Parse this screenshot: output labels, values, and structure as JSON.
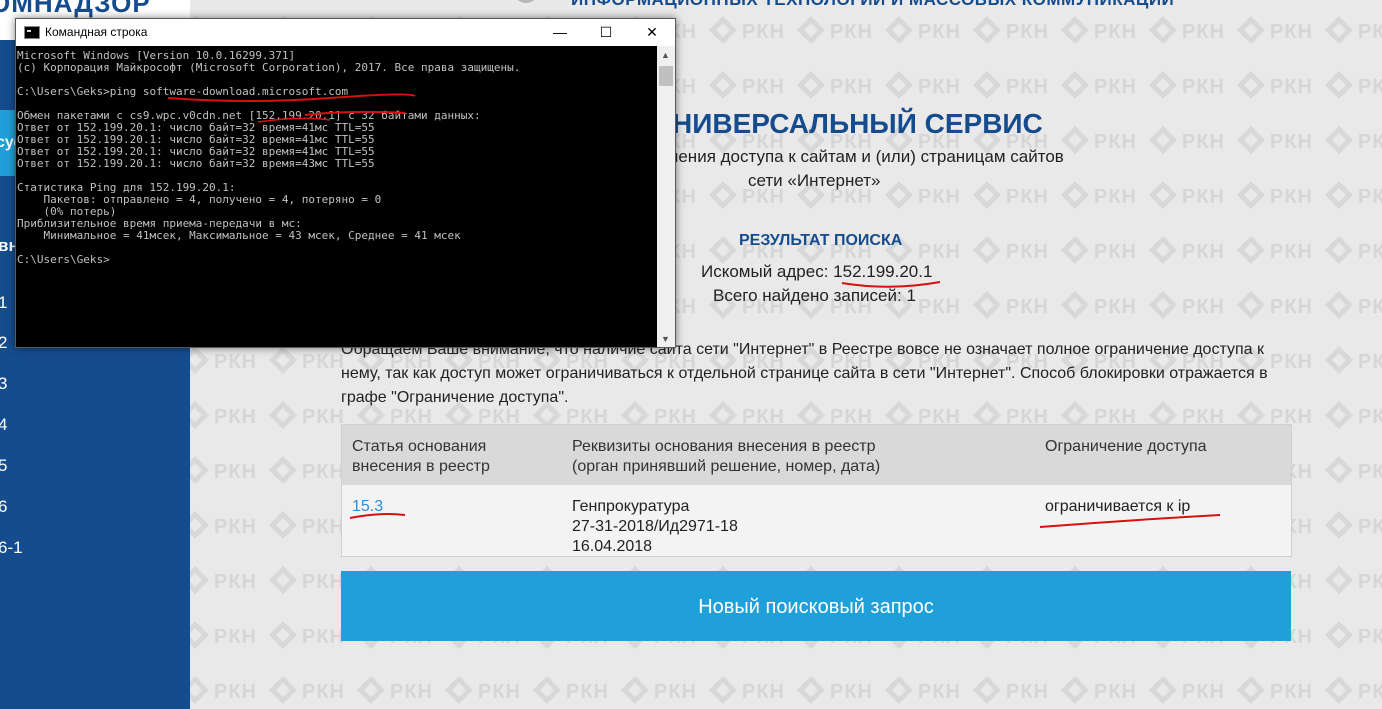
{
  "header": {
    "top_title": "ИНФОРМАЦИОННЫХ ТЕХНОЛОГИЙ И МАССОВЫХ КОММУНИКАЦИЙ",
    "logo_text": "ОМНАДЗОР"
  },
  "watermark_text": "РКН",
  "sidebar": {
    "active_label": "сус",
    "section_label": "вн",
    "items": [
      "1",
      "2",
      "3",
      "4",
      "5",
      "6",
      "6-1"
    ]
  },
  "service": {
    "title": "НИВЕРСАЛЬНЫЙ СЕРВИС",
    "subtitle_line1": "ичения доступа к сайтам и (или) страницам сайтов",
    "subtitle_line2": "сети «Интернет»"
  },
  "result": {
    "title": "РЕЗУЛЬТАТ ПОИСКА",
    "address_label": "Искомый адрес: ",
    "address_value": "152.199.20.1",
    "count_label": "Всего найдено записей: ",
    "count_value": "1"
  },
  "notice": "Обращаем Ваше внимание, что наличие сайта сети \"Интернет\" в Реестре вовсе не означает полное ограничение доступа к нему, так как доступ может ограничиваться к отдельной странице сайта в сети \"Интернет\". Способ блокировки отражается в графе \"Ограничение доступа\".",
  "table": {
    "headers": [
      [
        "Статья основания",
        "внесения в реестр"
      ],
      [
        "Реквизиты основания внесения в реестр",
        "(орган принявший решение, номер, дата)"
      ],
      [
        "Ограничение доступа"
      ]
    ],
    "row": {
      "article": "15.3",
      "details": [
        "Генпрокуратура",
        "27-31-2018/Ид2971-18",
        "16.04.2018"
      ],
      "restriction": "ограничивается к ip"
    }
  },
  "new_search_label": "Новый поисковый запрос",
  "cmd": {
    "title": "Командная строка",
    "minimize": "—",
    "maximize": "☐",
    "close": "✕",
    "lines": [
      "Microsoft Windows [Version 10.0.16299.371]",
      "(c) Корпорация Майкрософт (Microsoft Corporation), 2017. Все права защищены.",
      "",
      "C:\\Users\\Geks>ping software-download.microsoft.com",
      "",
      "Обмен пакетами с cs9.wpc.v0cdn.net [152.199.20.1] с 32 байтами данных:",
      "Ответ от 152.199.20.1: число байт=32 время=41мс TTL=55",
      "Ответ от 152.199.20.1: число байт=32 время=41мс TTL=55",
      "Ответ от 152.199.20.1: число байт=32 время=41мс TTL=55",
      "Ответ от 152.199.20.1: число байт=32 время=43мс TTL=55",
      "",
      "Статистика Ping для 152.199.20.1:",
      "    Пакетов: отправлено = 4, получено = 4, потеряно = 0",
      "    (0% потерь)",
      "Приблизительное время приема-передачи в мс:",
      "    Минимальное = 41мсек, Максимальное = 43 мсек, Среднее = 41 мсек",
      "",
      "C:\\Users\\Geks>"
    ]
  },
  "colors": {
    "brand_blue": "#154c8e",
    "accent_blue": "#1fa0d8",
    "link_blue": "#2a8fd6",
    "annotation_red": "#d81010"
  }
}
